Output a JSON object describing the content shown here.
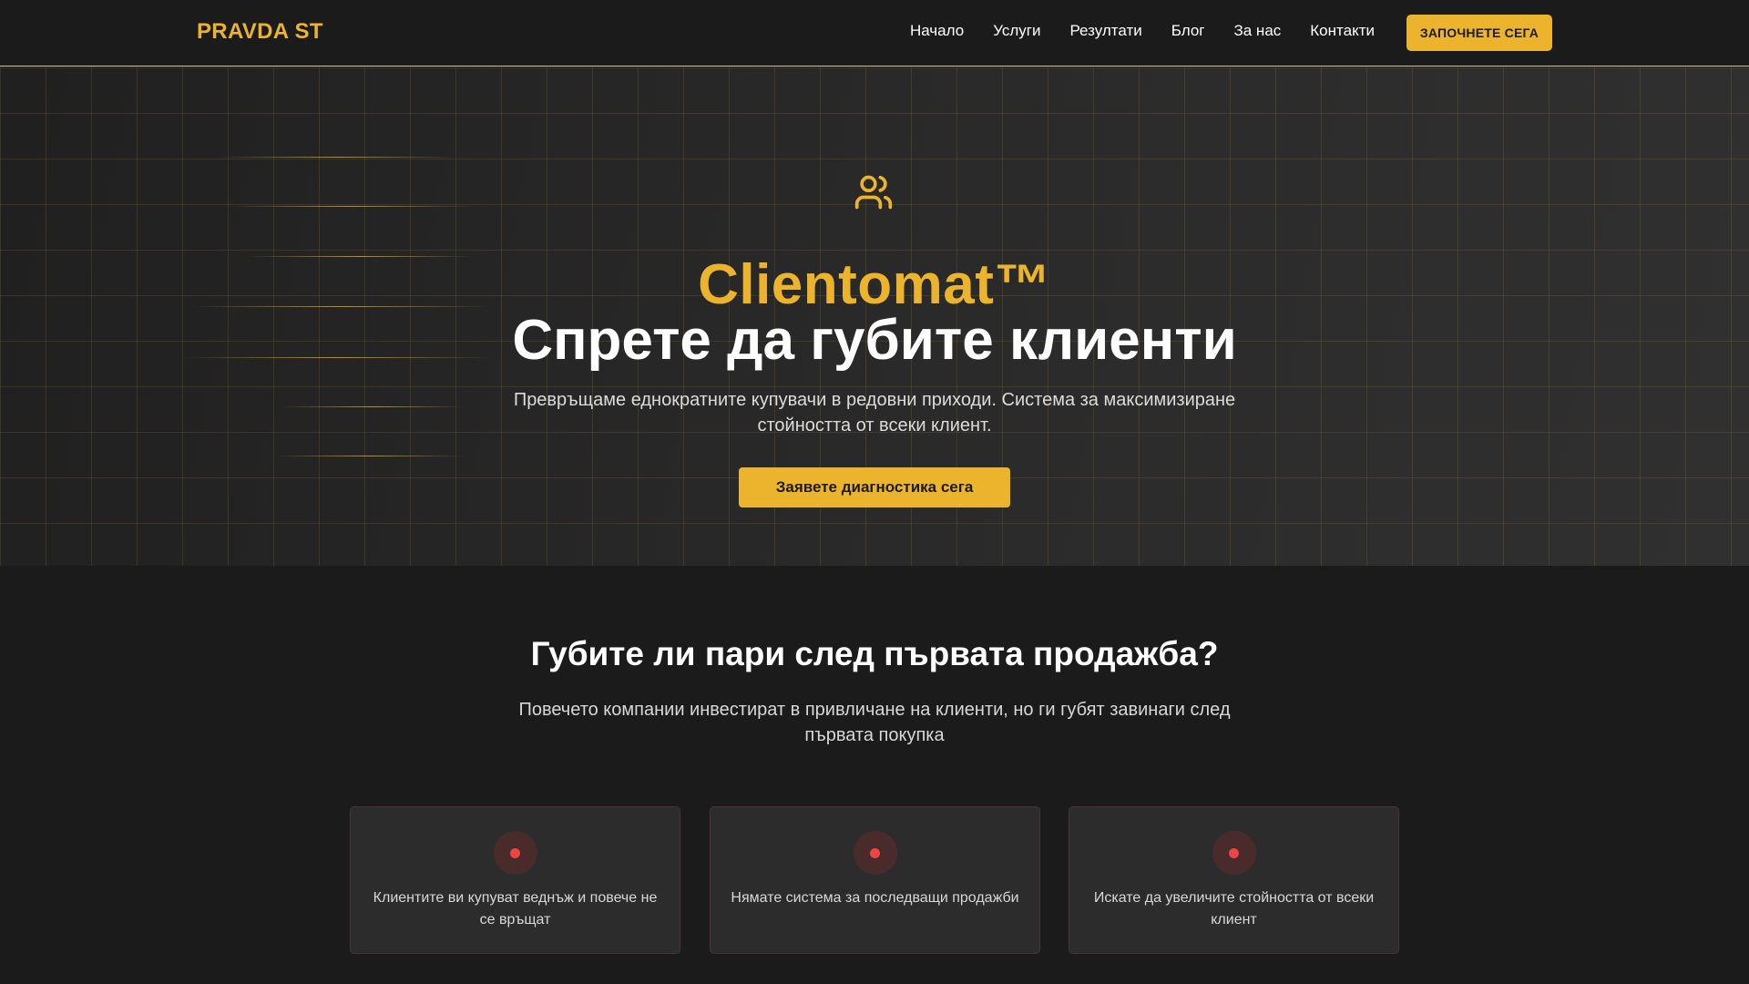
{
  "nav": {
    "logo": "PRAVDA ST",
    "links": [
      "Начало",
      "Услуги",
      "Резултати",
      "Блог",
      "За нас",
      "Контакти"
    ],
    "cta": "ЗАПОЧНЕТЕ СЕГА"
  },
  "hero": {
    "icon": "users-icon",
    "brand": "Clientomat™",
    "title": "Спрете да губите клиенти",
    "subtitle": "Превръщаме еднократните купувачи в редовни приходи. Система за максимизиране стойността от всеки клиент.",
    "cta": "Заявете диагностика сега"
  },
  "problem": {
    "title": "Губите ли пари след първата продажба?",
    "subtitle": "Повечето компании инвестират в привличане на клиенти, но ги губят завинаги след първата покупка",
    "cards": [
      {
        "icon": "red-dot-icon",
        "text": "Клиентите ви купуват веднъж и повече не се връщат"
      },
      {
        "icon": "red-dot-icon",
        "text": "Нямате система за последващи продажби"
      },
      {
        "icon": "red-dot-icon",
        "text": "Искате да увеличите стойността от всеки клиент"
      }
    ]
  },
  "colors": {
    "accent": "#ecb42c",
    "background": "#1b1b1b",
    "hero_background": "#272727",
    "card_background": "#2c2c2c",
    "alert": "#ef4444"
  }
}
